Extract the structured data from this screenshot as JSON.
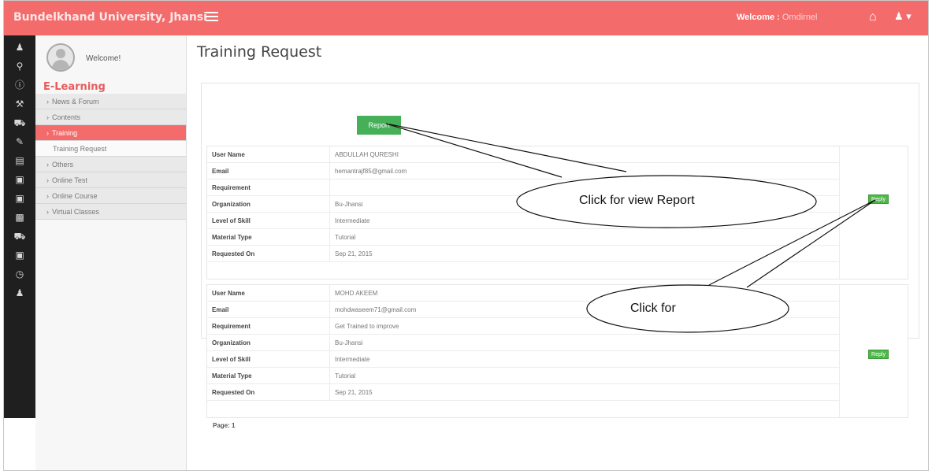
{
  "header": {
    "brand": "Bundelkhand University, Jhansi",
    "welcome_label": "Welcome :",
    "welcome_name": "Omdirnel",
    "colors": {
      "topbar": "#f46b6b",
      "iconbar": "#1f1f1f",
      "button_green": "#45b058"
    },
    "icons": [
      "menu-icon",
      "home-icon",
      "user-icon"
    ]
  },
  "sidebar": {
    "welcome": "Welcome!",
    "section_title": "E-Learning",
    "items": [
      {
        "label": "News & Forum",
        "state": "normal"
      },
      {
        "label": "Contents",
        "state": "normal"
      },
      {
        "label": "Training",
        "state": "active"
      },
      {
        "label": "Training Request",
        "state": "sub"
      },
      {
        "label": "Others",
        "state": "normal"
      },
      {
        "label": "Online Test",
        "state": "normal"
      },
      {
        "label": "Online Course",
        "state": "normal"
      },
      {
        "label": "Virtual Classes",
        "state": "normal"
      }
    ],
    "icon_strip": [
      "user-icon",
      "pin-icon",
      "info-icon",
      "tools-icon",
      "truck-icon",
      "edit-icon",
      "file-icon",
      "money-icon",
      "money-icon",
      "chart-icon",
      "cart-icon",
      "money-icon",
      "clock-icon",
      "user-icon"
    ]
  },
  "main": {
    "title": "Training Request",
    "report_button": "Report",
    "requests": [
      {
        "fields": [
          {
            "key": "User Name",
            "value": "ABDULLAH QURESHI"
          },
          {
            "key": "Email",
            "value": "hemantrajf85@gmail.com"
          },
          {
            "key": "Requirement",
            "value": ""
          },
          {
            "key": "Organization",
            "value": "Bu-Jhansi"
          },
          {
            "key": "Level of Skill",
            "value": "Intermediate"
          },
          {
            "key": "Material Type",
            "value": "Tutorial"
          },
          {
            "key": "Requested On",
            "value": "Sep 21, 2015"
          }
        ],
        "reply_label": "Reply"
      },
      {
        "fields": [
          {
            "key": "User Name",
            "value": "MOHD AKEEM"
          },
          {
            "key": "Email",
            "value": "mohdwaseem71@gmail.com"
          },
          {
            "key": "Requirement",
            "value": "Get Trained to improve"
          },
          {
            "key": "Organization",
            "value": "Bu-Jhansi"
          },
          {
            "key": "Level of Skill",
            "value": "Intermediate"
          },
          {
            "key": "Material Type",
            "value": "Tutorial"
          },
          {
            "key": "Requested On",
            "value": "Sep 21, 2015"
          }
        ],
        "reply_label": "Reply"
      }
    ],
    "pager": "Page: 1"
  },
  "annotations": {
    "callout_report": "Click for view Report",
    "callout_reply": "Click for"
  }
}
